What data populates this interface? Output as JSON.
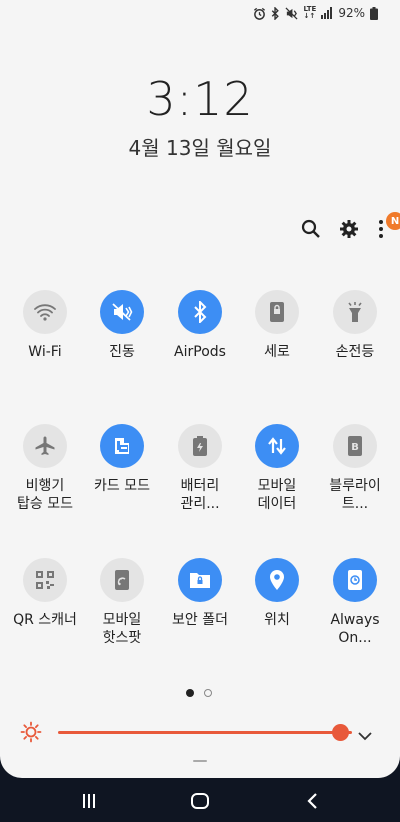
{
  "status_bar": {
    "battery_text": "92%",
    "network": "LTE",
    "icons": [
      "alarm-icon",
      "bluetooth-icon",
      "vibrate-icon",
      "lte-icon",
      "signal-icon",
      "battery-icon"
    ]
  },
  "clock": {
    "time": "3:12",
    "date": "4월 13일 월요일"
  },
  "top_actions": {
    "badge": "N",
    "icons": [
      "search-icon",
      "gear-icon",
      "more-icon"
    ]
  },
  "tiles": [
    {
      "label": "Wi-Fi",
      "icon": "wifi-icon",
      "on": false
    },
    {
      "label": "진동",
      "icon": "vibrate-icon",
      "on": true
    },
    {
      "label": "AirPods",
      "icon": "bluetooth-icon",
      "on": true
    },
    {
      "label": "세로",
      "icon": "portrait-lock-icon",
      "on": false
    },
    {
      "label": "손전등",
      "icon": "flashlight-icon",
      "on": false
    },
    {
      "label": "비행기\n탑승 모드",
      "icon": "airplane-icon",
      "on": false
    },
    {
      "label": "카드 모드",
      "icon": "card-mode-icon",
      "on": true
    },
    {
      "label": "배터리\n관리...",
      "icon": "battery-care-icon",
      "on": false
    },
    {
      "label": "모바일\n데이터",
      "icon": "mobile-data-icon",
      "on": true
    },
    {
      "label": "블루라이\n트...",
      "icon": "blue-light-icon",
      "on": false
    },
    {
      "label": "QR 스캐너",
      "icon": "qr-icon",
      "on": false
    },
    {
      "label": "모바일\n핫스팟",
      "icon": "hotspot-icon",
      "on": false
    },
    {
      "label": "보안 폴더",
      "icon": "secure-folder-icon",
      "on": true
    },
    {
      "label": "위치",
      "icon": "location-icon",
      "on": true
    },
    {
      "label": "Always\nOn...",
      "icon": "always-on-icon",
      "on": true
    }
  ],
  "pager": {
    "pages": 2,
    "current": 1
  },
  "brightness": {
    "level": 0.96,
    "accent": "#e8593a"
  },
  "colors": {
    "tile_on": "#3d8ef4",
    "tile_off": "#e4e4e4",
    "badge": "#f07a2a"
  }
}
